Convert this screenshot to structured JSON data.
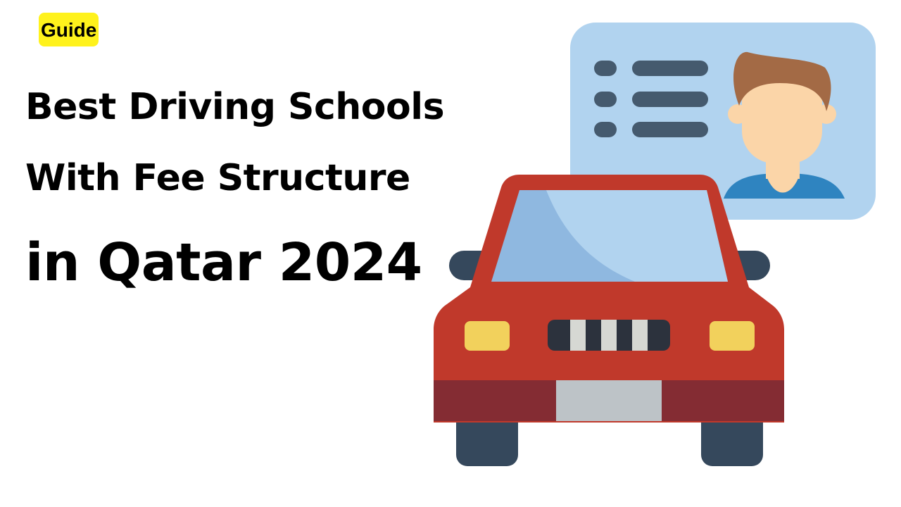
{
  "badge": {
    "label": "Guide"
  },
  "headline": {
    "line1": "Best Driving Schools",
    "line2": "With Fee Structure",
    "line3": "in Qatar 2024"
  },
  "illustration": {
    "icons": [
      "id-card-icon",
      "person-avatar-icon",
      "car-icon"
    ],
    "colors": {
      "card": "#b1d3ef",
      "card_lines": "#455a6e",
      "hair": "#a36a45",
      "skin": "#fbd5a8",
      "shirt": "#2f84c0",
      "car_body": "#c0392b",
      "car_bumper": "#842c33",
      "windshield": "#8fb8e0",
      "headlight": "#f2d15c",
      "tire": "#35485c",
      "grille": "#2c323d",
      "plate": "#bdc3c7"
    }
  }
}
